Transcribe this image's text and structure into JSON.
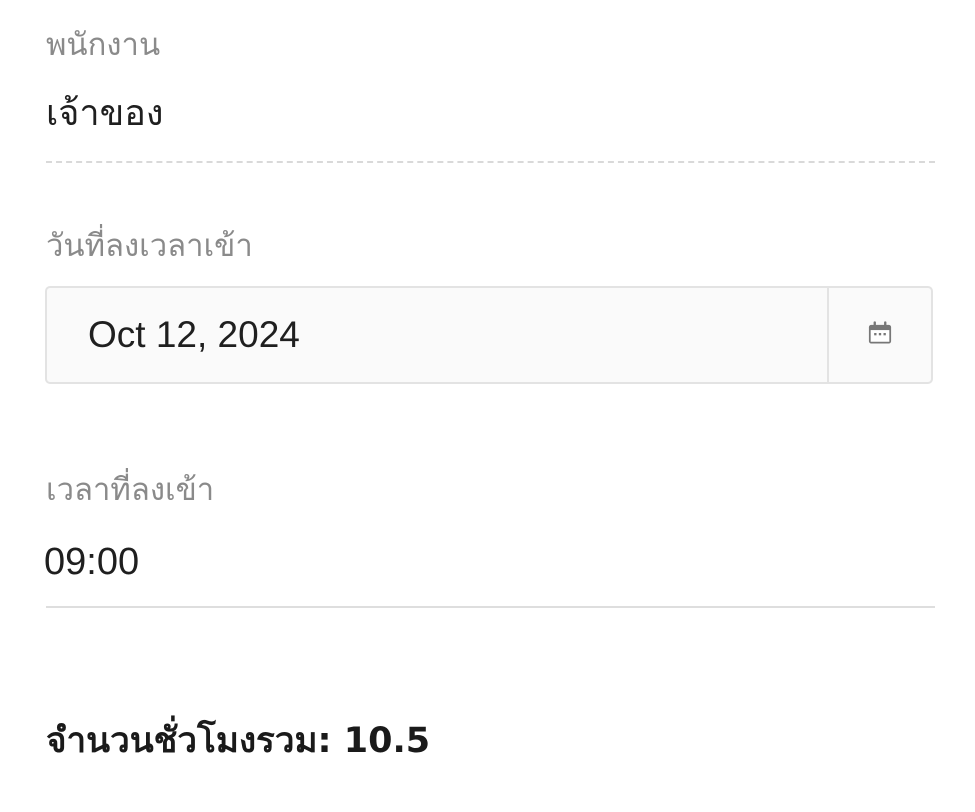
{
  "employee": {
    "label": "พนักงาน",
    "value": "เจ้าของ"
  },
  "checkin_date": {
    "label": "วันที่ลงเวลาเข้า",
    "value": "Oct 12, 2024",
    "icon": "calendar-icon"
  },
  "checkin_time": {
    "label": "เวลาที่ลงเข้า",
    "value": "09:00"
  },
  "total_hours": {
    "text": "จำนวนชั่วโมงรวม: 10.5"
  }
}
